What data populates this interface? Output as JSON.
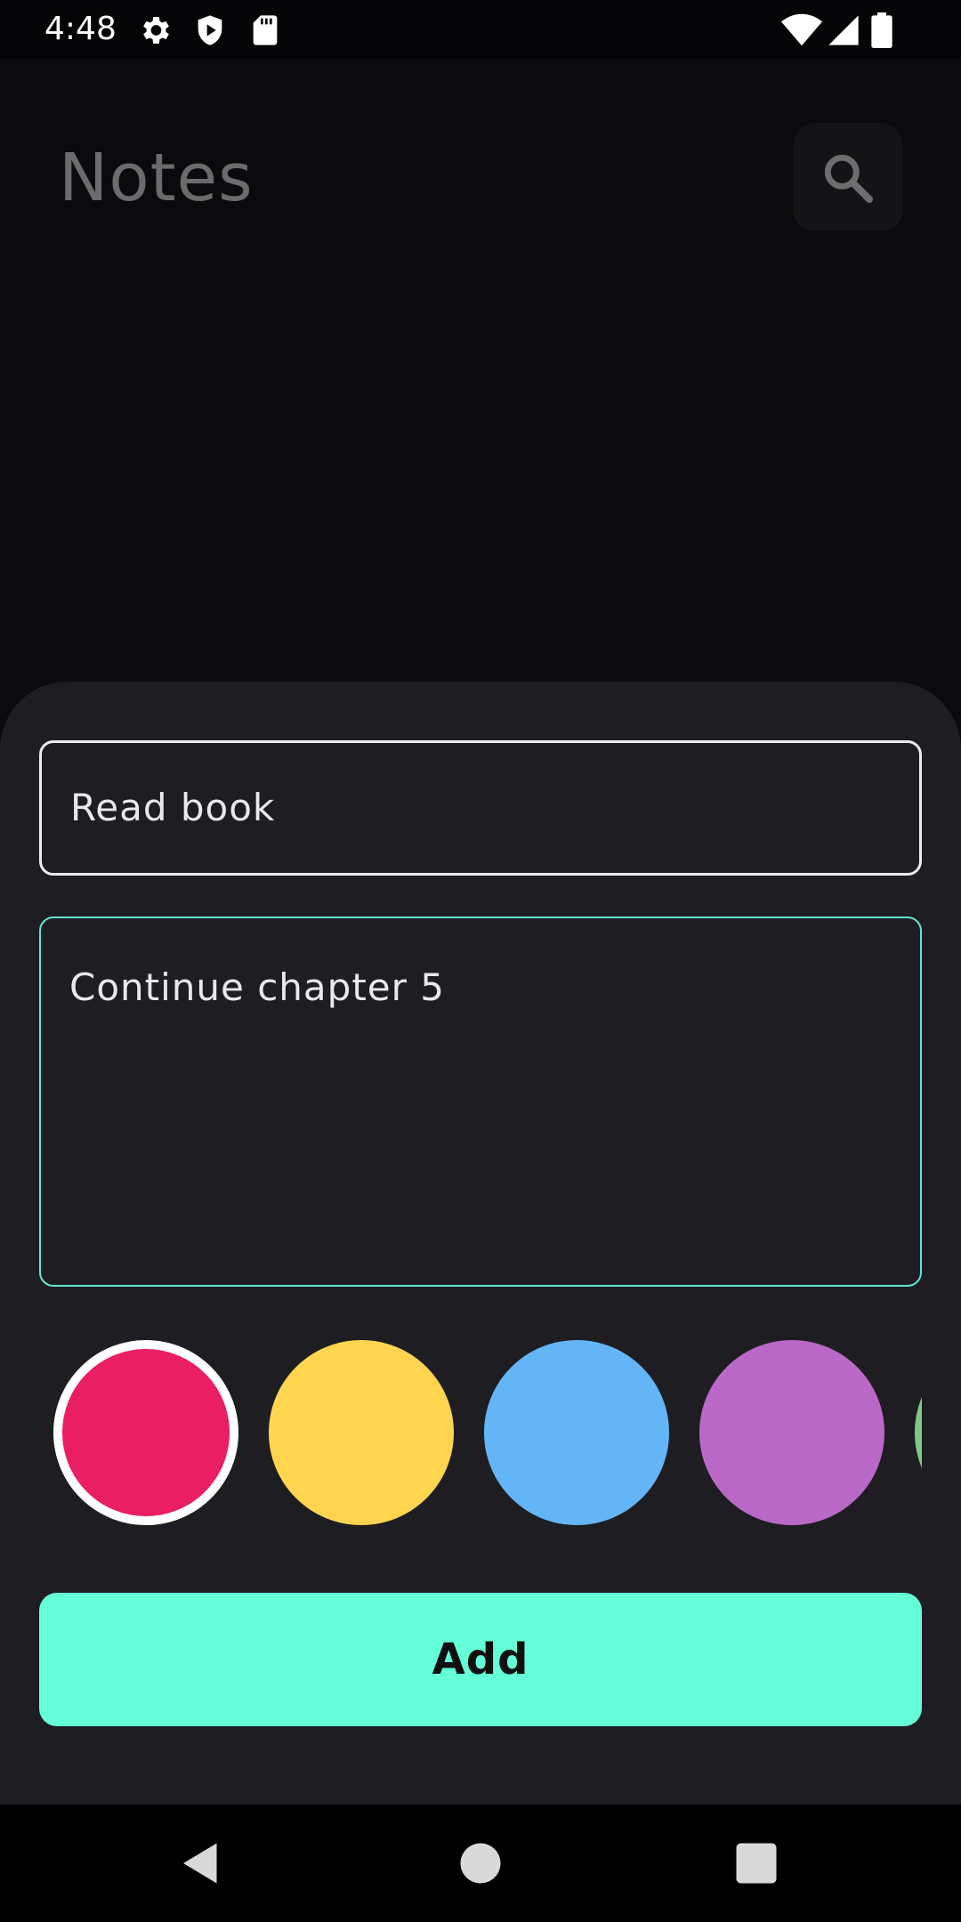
{
  "status_bar": {
    "time": "4:48",
    "icons_left": [
      "gear-icon",
      "play-protect-icon",
      "sd-card-icon"
    ],
    "icons_right": [
      "wifi-icon",
      "signal-icon",
      "battery-icon"
    ]
  },
  "header": {
    "title": "Notes",
    "search_icon": "search-icon"
  },
  "sheet": {
    "title_field": {
      "value": "Read book"
    },
    "content_field": {
      "value": "Continue chapter 5"
    },
    "colors": [
      {
        "name": "red",
        "hex": "#E91E63",
        "selected": true
      },
      {
        "name": "yellow",
        "hex": "#FFD54F",
        "selected": false
      },
      {
        "name": "blue",
        "hex": "#64B5F6",
        "selected": false
      },
      {
        "name": "purple",
        "hex": "#BA68C8",
        "selected": false
      },
      {
        "name": "green",
        "hex": "#81C784",
        "selected": false
      }
    ],
    "add_label": "Add"
  },
  "colors": {
    "accent": "#64FFD8",
    "sheet_bg": "#1E1D22",
    "screen_bg": "#0B0B0D"
  },
  "nav_bar": {
    "buttons": [
      "back-icon",
      "home-icon",
      "recents-icon"
    ]
  }
}
